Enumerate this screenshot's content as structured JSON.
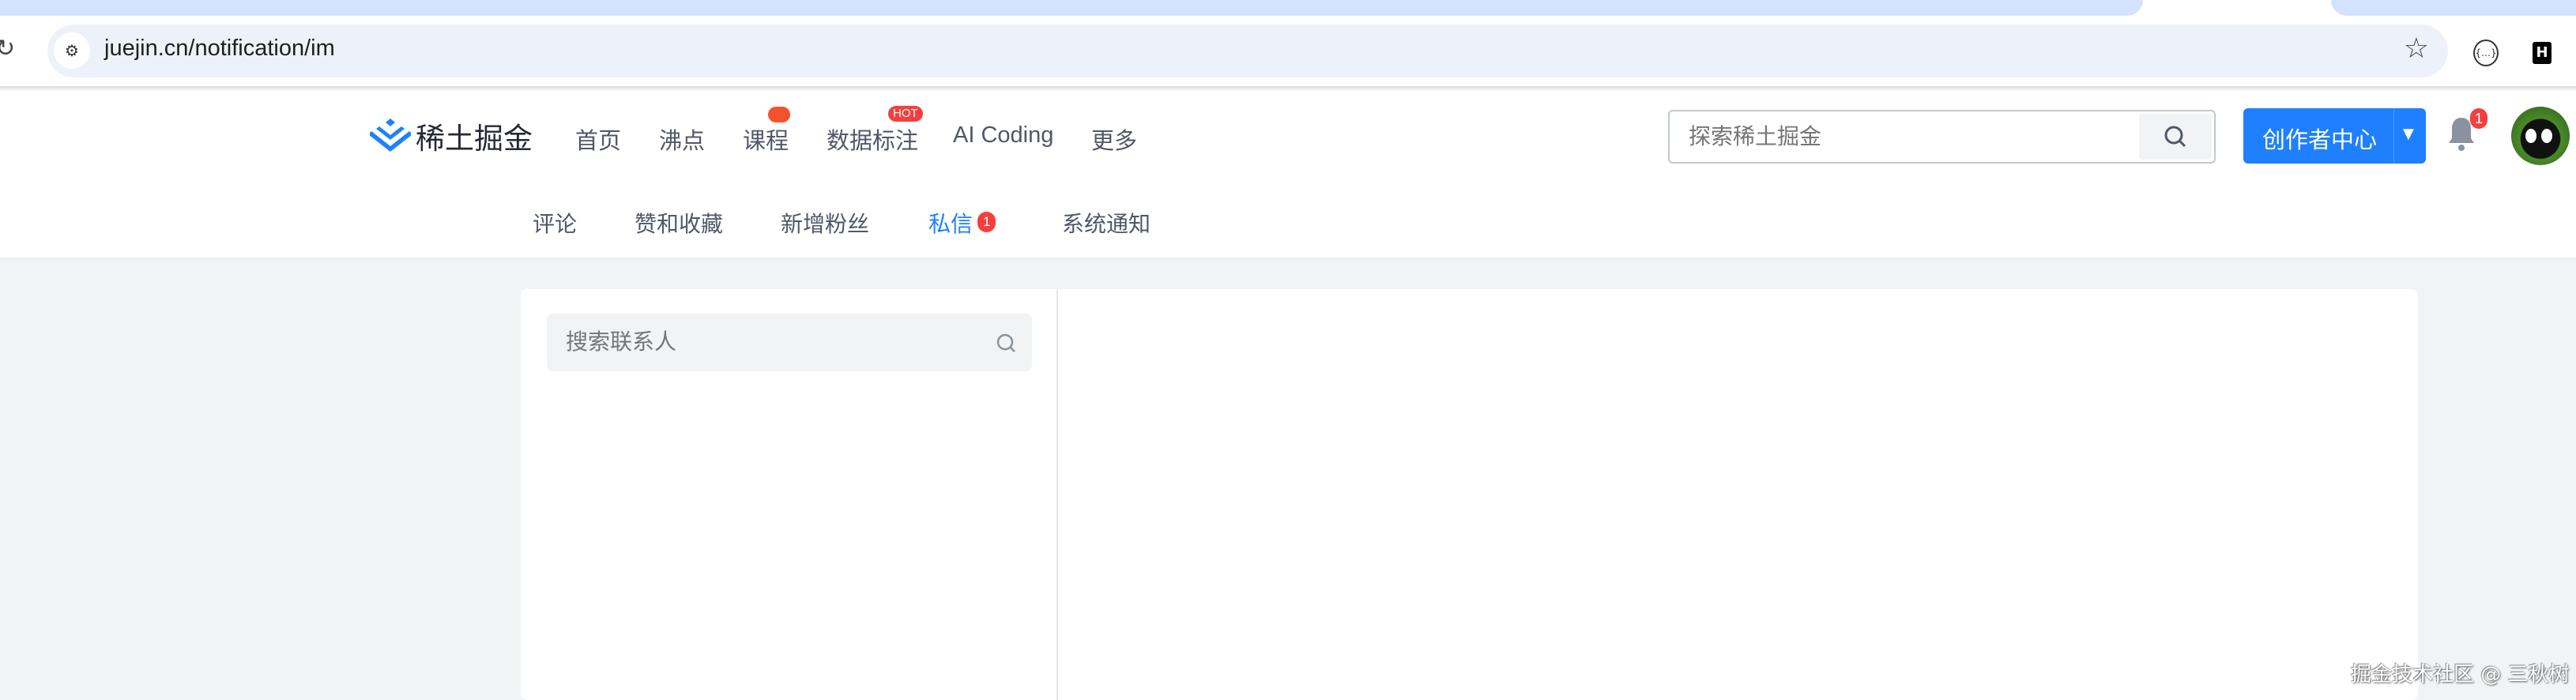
{
  "browser": {
    "url": "juejin.cn/notification/im"
  },
  "header": {
    "logo_text": "稀土掘金",
    "nav": [
      {
        "label": "首页"
      },
      {
        "label": "沸点"
      },
      {
        "label": "课程",
        "badge": ""
      },
      {
        "label": "数据标注",
        "badge": "HOT"
      },
      {
        "label": "AI Coding"
      },
      {
        "label": "更多"
      }
    ],
    "search_placeholder": "探索稀土掘金",
    "creator_label": "创作者中心",
    "notification_count": "1"
  },
  "subnav": {
    "items": [
      {
        "label": "评论"
      },
      {
        "label": "赞和收藏"
      },
      {
        "label": "新增粉丝"
      },
      {
        "label": "私信",
        "badge": "1",
        "active": true
      },
      {
        "label": "系统通知"
      }
    ]
  },
  "im": {
    "contact_search_placeholder": "搜索联系人"
  },
  "watermark": "掘金技术社区 @ 三秋树",
  "colors": {
    "brand": "#1e80ff",
    "badge": "#f53f3f",
    "text": "#515767",
    "background": "#f2f3f5"
  }
}
